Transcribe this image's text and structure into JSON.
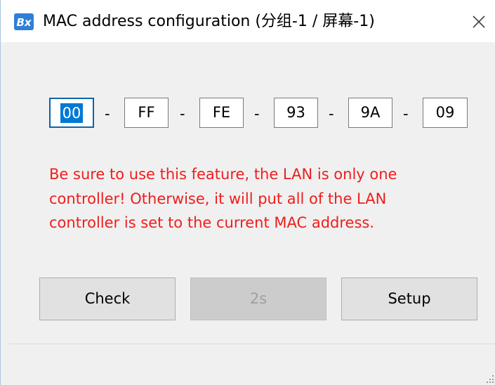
{
  "window": {
    "title": "MAC address configuration  (分组-1 / 屏幕-1)",
    "app_icon_label": "Bx"
  },
  "mac": {
    "octets": [
      "00",
      "FF",
      "FE",
      "93",
      "9A",
      "09"
    ],
    "separator": "-",
    "focused_index": 0
  },
  "warning": {
    "line1": "Be sure to use this feature, the LAN is only one",
    "line2": "controller! Otherwise, it will put all of the LAN",
    "line3": "controller is set to the current MAC address.",
    "color": "#ef1d1d"
  },
  "buttons": {
    "check_label": "Check",
    "countdown_label": "2s",
    "setup_label": "Setup"
  },
  "icons": {
    "app": "bx-app-icon",
    "close": "close-icon",
    "grip": "resize-grip-icon"
  },
  "colors": {
    "selection": "#0078d7",
    "focus_border": "#0a64ad",
    "button_bg": "#e1e1e1",
    "disabled_bg": "#cccccc"
  }
}
